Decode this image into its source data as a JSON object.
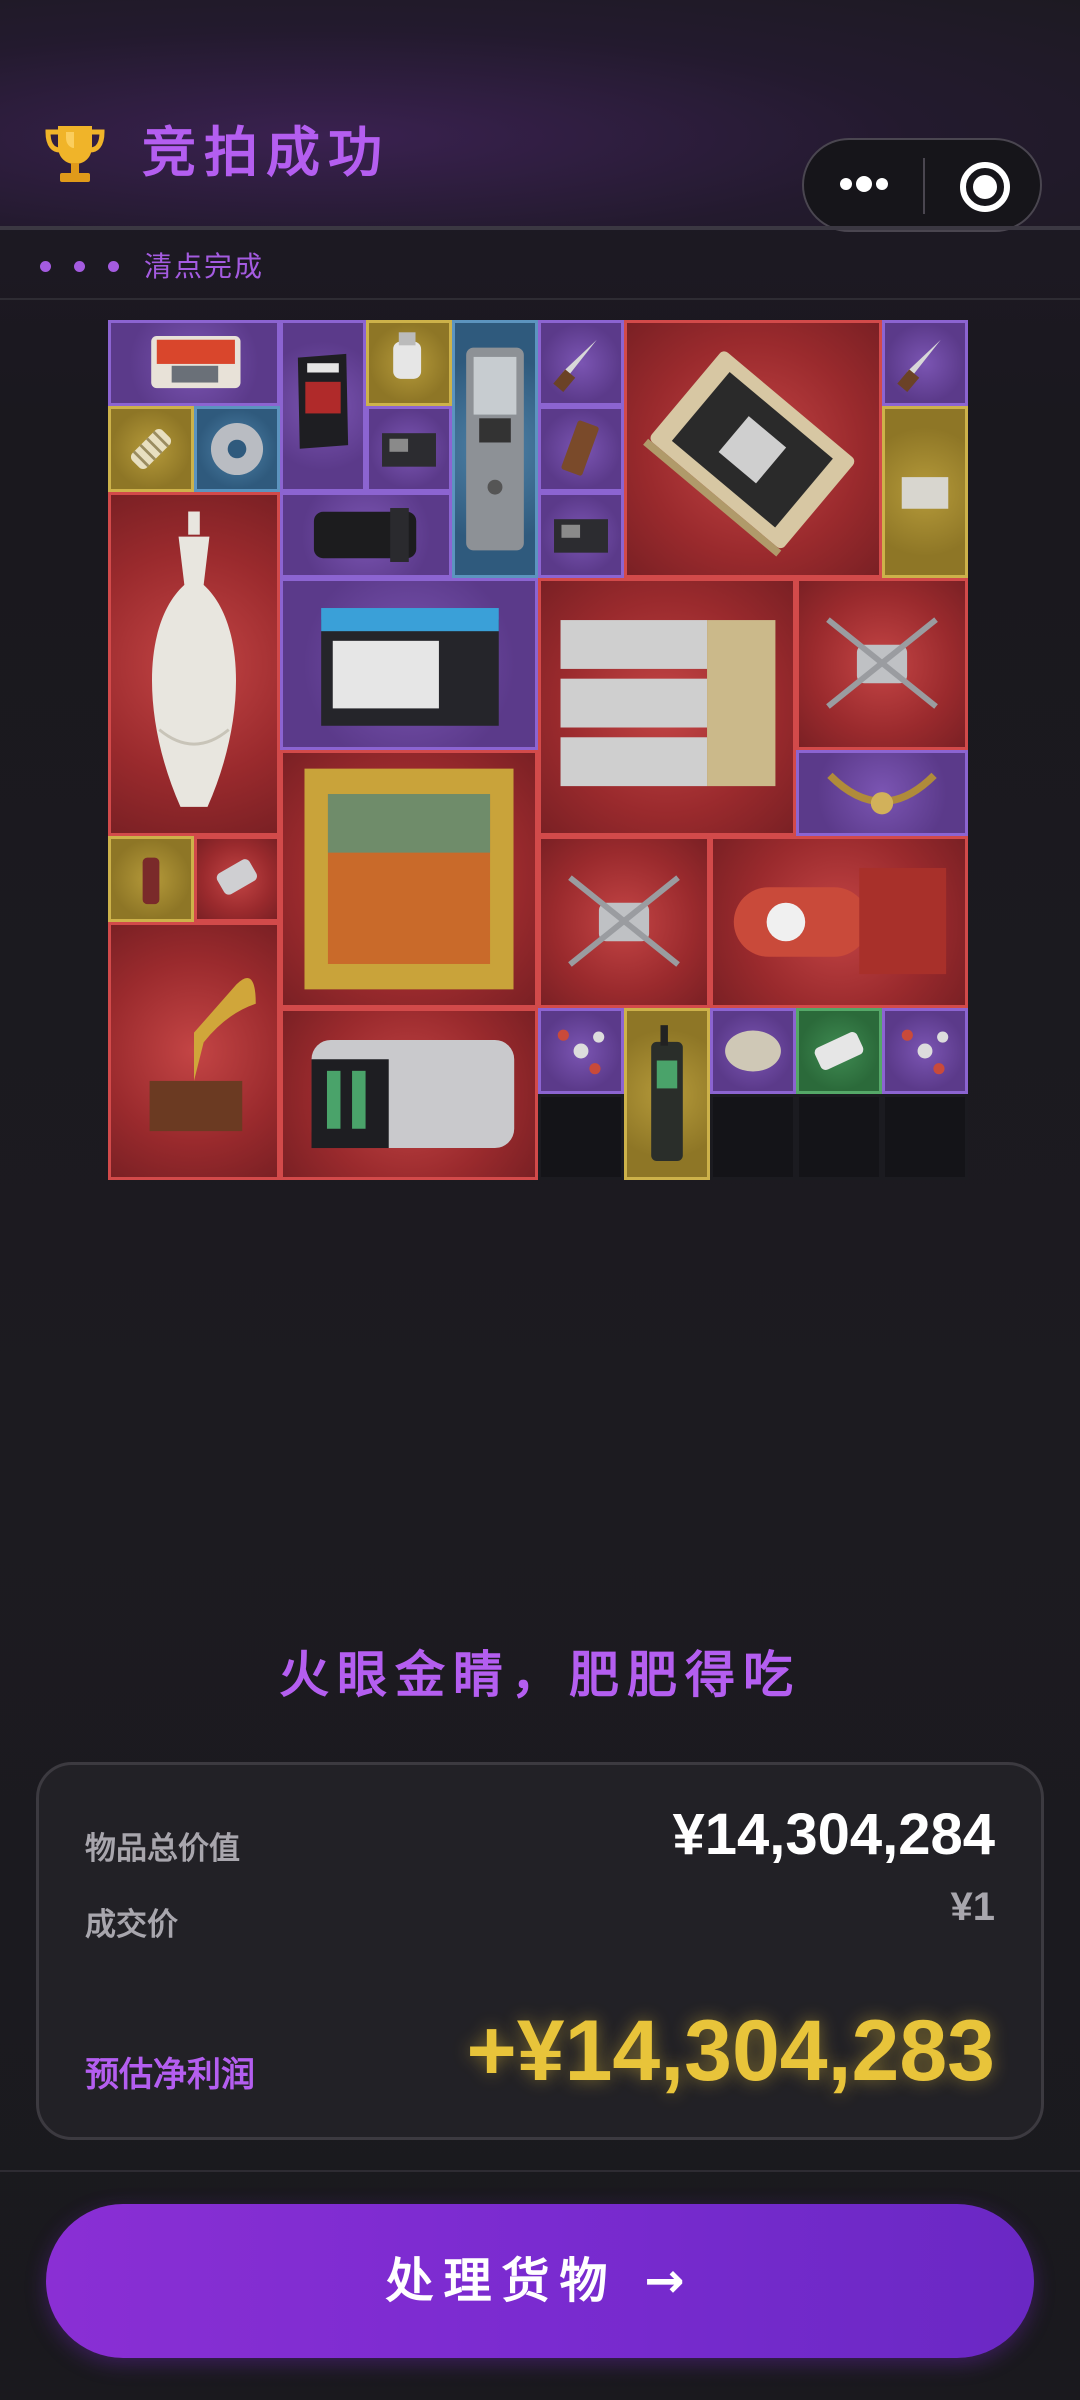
{
  "header": {
    "title": "竞拍成功",
    "subtitle": "清点完成"
  },
  "icons": {
    "trophy": "trophy-icon",
    "more": "more-dots-icon",
    "close": "target-close-icon"
  },
  "items": [
    {
      "name": "ssd-package",
      "rarity": "purple"
    },
    {
      "name": "snack-bag",
      "rarity": "purple"
    },
    {
      "name": "usb-drive",
      "rarity": "yellow"
    },
    {
      "name": "walkie-talkie",
      "rarity": "blue"
    },
    {
      "name": "knife",
      "rarity": "purple"
    },
    {
      "name": "graphics-card",
      "rarity": "red"
    },
    {
      "name": "knife",
      "rarity": "purple"
    },
    {
      "name": "spring-coil",
      "rarity": "yellow"
    },
    {
      "name": "cd-disc",
      "rarity": "blue"
    },
    {
      "name": "circuit-board",
      "rarity": "purple"
    },
    {
      "name": "chocolate-bar",
      "rarity": "purple"
    },
    {
      "name": "document-card",
      "rarity": "yellow"
    },
    {
      "name": "camera-lens",
      "rarity": "purple"
    },
    {
      "name": "circuit-board",
      "rarity": "purple"
    },
    {
      "name": "porcelain-vase",
      "rarity": "red"
    },
    {
      "name": "car-battery",
      "rarity": "purple"
    },
    {
      "name": "server-rack",
      "rarity": "red"
    },
    {
      "name": "drone",
      "rarity": "red"
    },
    {
      "name": "horn-crown",
      "rarity": "purple"
    },
    {
      "name": "framed-painting",
      "rarity": "red"
    },
    {
      "name": "small-bottle",
      "rarity": "yellow"
    },
    {
      "name": "metal-part",
      "rarity": "red"
    },
    {
      "name": "drone",
      "rarity": "red"
    },
    {
      "name": "fuel-tank",
      "rarity": "red"
    },
    {
      "name": "gramophone",
      "rarity": "red"
    },
    {
      "name": "server-chassis",
      "rarity": "red"
    },
    {
      "name": "molecule-model",
      "rarity": "purple"
    },
    {
      "name": "satellite-phone",
      "rarity": "yellow"
    },
    {
      "name": "round-stone",
      "rarity": "purple"
    },
    {
      "name": "power-strip",
      "rarity": "green"
    },
    {
      "name": "molecule-model",
      "rarity": "purple"
    }
  ],
  "slogan": "火眼金睛，肥肥得吃",
  "summary": {
    "total_label": "物品总价值",
    "total_value": "¥14,304,284",
    "price_label": "成交价",
    "price_value": "¥1",
    "profit_label": "预估净利润",
    "profit_value": "+¥14,304,283"
  },
  "cta": {
    "label": "处理货物 →"
  },
  "colors": {
    "accent": "#b45ef0",
    "gold": "#e8c43a",
    "rarity_red": "#c44545",
    "rarity_purple": "#7b55b3",
    "rarity_yellow": "#b59a3a",
    "rarity_blue": "#4e82a8",
    "rarity_green": "#3f8b52"
  }
}
